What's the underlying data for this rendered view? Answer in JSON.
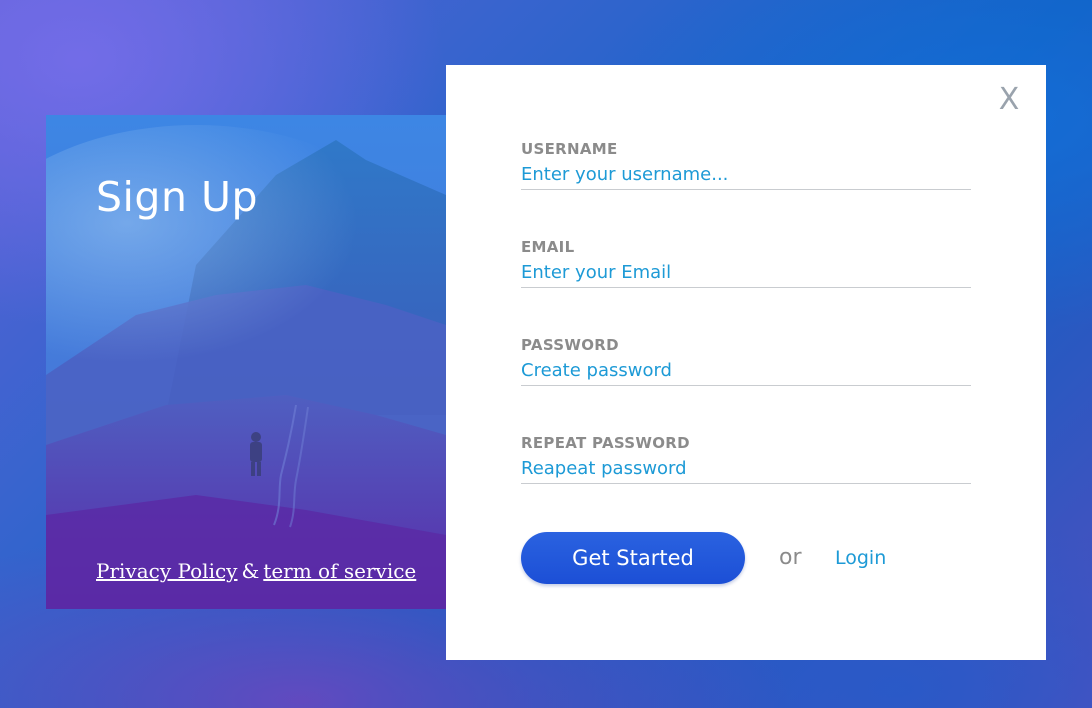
{
  "hero": {
    "title": "Sign Up",
    "privacy_link": "Privacy Policy",
    "separator": "&",
    "terms_link": "term of service"
  },
  "form": {
    "close_label": "X",
    "fields": [
      {
        "label": "USERNAME",
        "placeholder": "Enter your username..."
      },
      {
        "label": "EMAIL",
        "placeholder": "Enter your Email"
      },
      {
        "label": "PASSWORD",
        "placeholder": "Create password"
      },
      {
        "label": "REPEAT PASSWORD",
        "placeholder": "Reapeat password"
      }
    ],
    "submit_label": "Get Started",
    "or_text": "or",
    "login_label": "Login"
  },
  "colors": {
    "accent_blue": "#1d9ad6",
    "button_blue": "#1c4fd6",
    "label_gray": "#8b8b8b"
  }
}
